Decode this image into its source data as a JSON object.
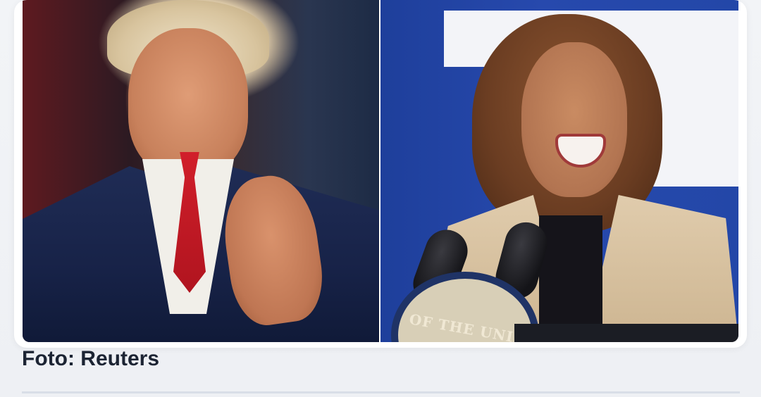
{
  "article": {
    "image": {
      "left_photo": {
        "alt": ""
      },
      "right_photo": {
        "alt": "",
        "seal_text": "OF THE UNI"
      }
    },
    "caption": "Foto: Reuters"
  }
}
